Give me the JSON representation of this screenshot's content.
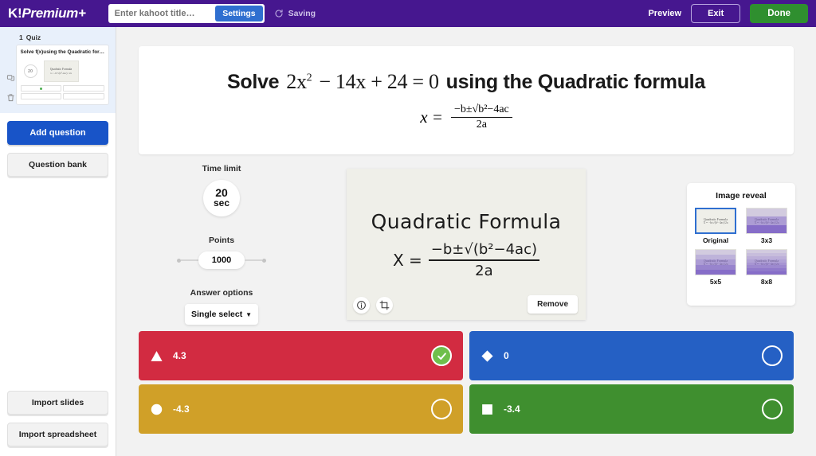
{
  "topbar": {
    "logo_k": "K!",
    "logo_text": "Premium+",
    "title_placeholder": "Enter kahoot title…",
    "title_value": "",
    "settings_label": "Settings",
    "saving_label": "Saving",
    "saving_icon": "refresh-spinner-icon",
    "preview_label": "Preview",
    "exit_label": "Exit",
    "done_label": "Done",
    "bg_color": "#46178f",
    "done_color": "#2f8f2f",
    "settings_color": "#2f6fd0"
  },
  "sidebar": {
    "question_number": "1",
    "question_type": "Quiz",
    "card": {
      "title": "Solve f(x)using the Quadratic for…",
      "time": "20",
      "thumb_title": "Quadratic Formula",
      "thumb_formula": "x = -b±√(b²-4ac) / 2a",
      "answers": [
        "",
        "",
        "",
        ""
      ],
      "correct_index": 0
    },
    "duplicate_icon": "duplicate-icon",
    "delete_icon": "trash-icon",
    "add_question_label": "Add question",
    "question_bank_label": "Question bank",
    "import_slides_label": "Import slides",
    "import_spreadsheet_label": "Import spreadsheet"
  },
  "question": {
    "prefix": "Solve",
    "expr_a": "2x",
    "expr_sup": "2",
    "expr_b": "− 14x + 24 = 0",
    "suffix": "using the Quadratic formula",
    "formula_lhs": "x =",
    "formula_num": "−b±√b²−4ac",
    "formula_den": "2a"
  },
  "controls": {
    "time_limit_label": "Time limit",
    "time_value": "20",
    "time_unit": "sec",
    "points_label": "Points",
    "points_value": "1000",
    "answer_options_label": "Answer options",
    "answer_options_value": "Single select",
    "caret_icon": "chevron-down-icon"
  },
  "media": {
    "hand_title": "Quadratic Formula",
    "hand_lhs": "X =",
    "hand_num": "−b±√(b²−4ac)",
    "hand_den": "2a",
    "info_icon": "info-icon",
    "crop_icon": "crop-icon",
    "remove_label": "Remove"
  },
  "image_reveal": {
    "title": "Image reveal",
    "options": [
      {
        "label": "Original",
        "grid": 1,
        "selected": true
      },
      {
        "label": "3x3",
        "grid": 3,
        "selected": false
      },
      {
        "label": "5x5",
        "grid": 5,
        "selected": false
      },
      {
        "label": "8x8",
        "grid": 8,
        "selected": false
      }
    ],
    "tile_color": "#7a5ec4",
    "selected_border": "#2f6fd0"
  },
  "answers": [
    {
      "text": "4.3",
      "shape": "triangle",
      "color": "#d22b41",
      "correct": true
    },
    {
      "text": "0",
      "shape": "diamond",
      "color": "#2560c4",
      "correct": false
    },
    {
      "text": "-4.3",
      "shape": "circle",
      "color": "#d0a028",
      "correct": false
    },
    {
      "text": "-3.4",
      "shape": "square",
      "color": "#3f8f2f",
      "correct": false
    }
  ]
}
